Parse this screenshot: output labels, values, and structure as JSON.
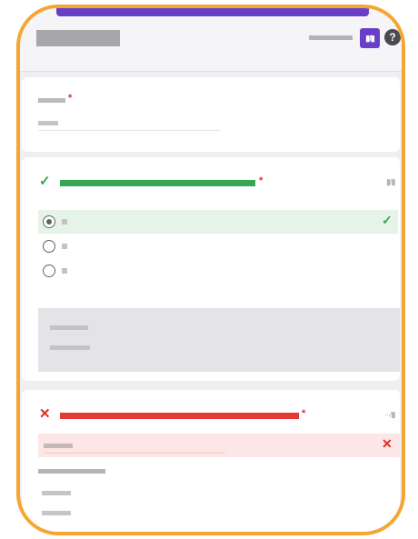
{
  "header": {
    "title": "",
    "score_label": "▮/▮",
    "help_icon": "?",
    "accent_color": "#6a3fc8"
  },
  "frame_color": "#f5a631",
  "questions": [
    {
      "type": "short-answer",
      "required": true,
      "required_mark": "*"
    },
    {
      "type": "multiple-choice",
      "status": "correct",
      "status_icon": "✓",
      "required_mark": "*",
      "points": "▮/▮",
      "options": [
        {
          "selected": true,
          "correct": true,
          "status_icon": "✓"
        },
        {
          "selected": false
        },
        {
          "selected": false
        }
      ]
    },
    {
      "type": "short-answer",
      "status": "incorrect",
      "status_icon": "✕",
      "required_mark": "*",
      "points": "···/▮",
      "answer_status_icon": "✕"
    }
  ],
  "colors": {
    "correct": "#34a853",
    "incorrect": "#e53935",
    "required": "#d93025"
  }
}
